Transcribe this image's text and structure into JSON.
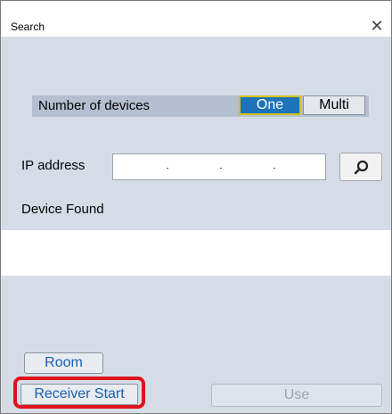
{
  "window": {
    "title": "Search",
    "close_glyph": "✕"
  },
  "devices": {
    "label": "Number of devices",
    "options": [
      "One",
      "Multi"
    ],
    "selected": "One"
  },
  "ip": {
    "label": "IP address",
    "value": ""
  },
  "found": {
    "label": "Device Found",
    "items": []
  },
  "buttons": {
    "room": "Room",
    "receiver_start": "Receiver Start",
    "use": "Use"
  },
  "icons": {
    "search": "magnifier-icon"
  },
  "colors": {
    "background": "#d6dce6",
    "selected_option": "#1e72b8",
    "selected_border": "#d4c21a",
    "button_text": "#1a5fb0",
    "highlight": "#e0131b"
  }
}
